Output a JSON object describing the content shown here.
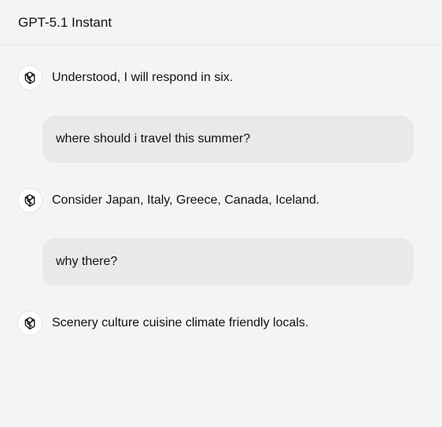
{
  "header": {
    "title": "GPT-5.1 Instant"
  },
  "messages": [
    {
      "role": "assistant",
      "text": "Understood, I will respond in six.",
      "icon": "openai-logo-icon"
    },
    {
      "role": "user",
      "text": "where should i travel this summer?"
    },
    {
      "role": "assistant",
      "text": "Consider Japan, Italy, Greece, Canada, Iceland.",
      "icon": "openai-logo-icon"
    },
    {
      "role": "user",
      "text": "why there?"
    },
    {
      "role": "assistant",
      "text": "Scenery culture cuisine climate friendly locals.",
      "icon": "openai-logo-icon"
    }
  ],
  "colors": {
    "background": "#f4f4f4",
    "user_bubble": "#e9e9e9",
    "text": "#111111"
  }
}
